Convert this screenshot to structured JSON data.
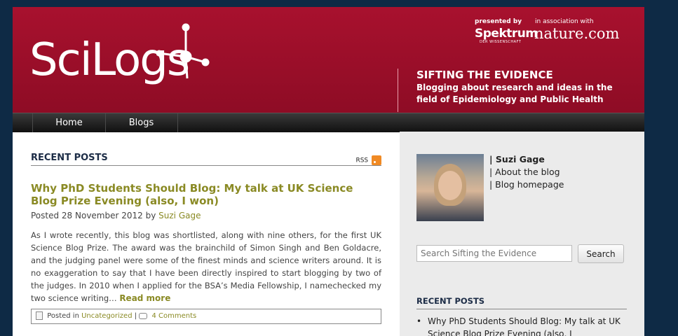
{
  "header": {
    "logo": "SciLogs",
    "presented_by": "presented by",
    "spektrum": "Spektrum",
    "spektrum_sub": "DER WISSENSCHAFT",
    "in_association": "in association with",
    "nature": "nature.com",
    "blog_title": "SIFTING THE EVIDENCE",
    "blog_subtitle": "Blogging about research and ideas in the field of Epidemiology and Public Health"
  },
  "nav": {
    "items": [
      {
        "label": "Home"
      },
      {
        "label": "Blogs"
      }
    ]
  },
  "main": {
    "recent_posts_heading": "RECENT POSTS",
    "rss_label": "RSS",
    "post": {
      "title": "Why PhD Students Should Blog: My talk at UK Science Blog Prize Evening (also, I won)",
      "posted_prefix": "Posted 28 November 2012 by",
      "author": "Suzi Gage",
      "excerpt": "As I wrote recently, this blog was shortlisted, along with nine others, for the first UK Science Blog Prize. The award was the brainchild of Simon Singh and Ben Goldacre, and the judging panel were some of the finest minds and science writers around. It is no exaggeration to say that I have been directly inspired to start blogging by two of the judges. In 2010 when I applied for the BSA’s Media Fellowship, I namechecked my two science writing…",
      "read_more": "Read more",
      "posted_in_label": "Posted in",
      "category": "Uncategorized",
      "separator": "|",
      "comments": "4 Comments"
    }
  },
  "sidebar": {
    "author_name": "| Suzi Gage",
    "about_link": "| About the blog",
    "homepage_link": "| Blog homepage",
    "search_placeholder": "Search Sifting the Evidence",
    "search_button": "Search",
    "recent_posts_heading": "RECENT POSTS",
    "recent_posts": [
      {
        "title": "Why PhD Students Should Blog: My talk at UK Science Blog Prize Evening (also, I"
      }
    ]
  },
  "colors": {
    "header_red": "#a8112e",
    "link_olive": "#8a8a24",
    "heading_navy": "#1c2c46",
    "rss_orange": "#f08a24"
  },
  "icons": [
    "rss-icon",
    "document-icon",
    "comment-icon"
  ]
}
